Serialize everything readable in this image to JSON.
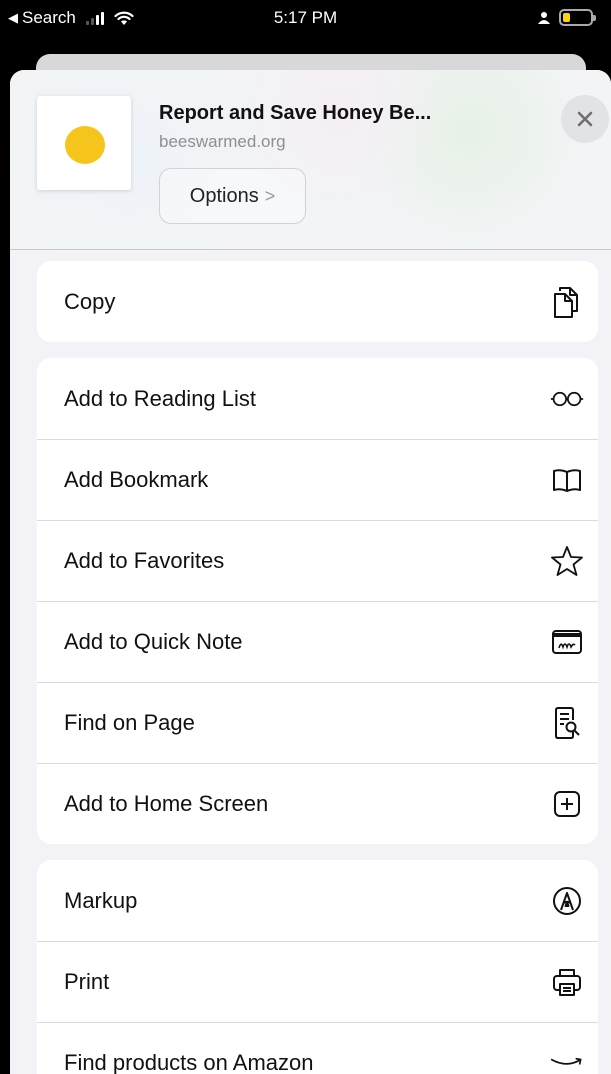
{
  "status_bar": {
    "back_label": "Search",
    "time": "5:17 PM"
  },
  "header": {
    "title": "Report and Save Honey Be...",
    "domain": "beeswarmed.org",
    "options_label": "Options",
    "options_chevron": ">",
    "thumbnail_color": "#f5c51c"
  },
  "groups": [
    {
      "items": [
        {
          "label": "Copy",
          "icon": "copy-icon"
        }
      ]
    },
    {
      "items": [
        {
          "label": "Add to Reading List",
          "icon": "glasses-icon"
        },
        {
          "label": "Add Bookmark",
          "icon": "book-icon"
        },
        {
          "label": "Add to Favorites",
          "icon": "star-icon"
        },
        {
          "label": "Add to Quick Note",
          "icon": "quick-note-icon"
        },
        {
          "label": "Find on Page",
          "icon": "find-on-page-icon"
        },
        {
          "label": "Add to Home Screen",
          "icon": "plus-square-icon"
        }
      ]
    },
    {
      "items": [
        {
          "label": "Markup",
          "icon": "markup-icon"
        },
        {
          "label": "Print",
          "icon": "printer-icon"
        },
        {
          "label": "Find products on Amazon",
          "icon": "amazon-smile-icon"
        }
      ]
    }
  ]
}
